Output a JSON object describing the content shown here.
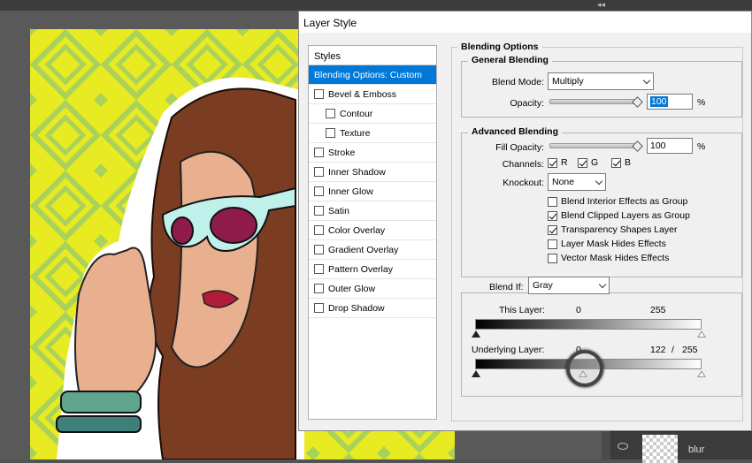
{
  "dialog": {
    "title": "Layer Style"
  },
  "styles_panel": {
    "header": "Styles",
    "items": [
      {
        "label": "Blending Options: Custom",
        "selected": true,
        "checkbox": false,
        "indent": false,
        "checked": false
      },
      {
        "label": "Bevel & Emboss",
        "checkbox": true,
        "indent": false,
        "checked": false
      },
      {
        "label": "Contour",
        "checkbox": true,
        "indent": true,
        "checked": false
      },
      {
        "label": "Texture",
        "checkbox": true,
        "indent": true,
        "checked": false
      },
      {
        "label": "Stroke",
        "checkbox": true,
        "indent": false,
        "checked": false
      },
      {
        "label": "Inner Shadow",
        "checkbox": true,
        "indent": false,
        "checked": false
      },
      {
        "label": "Inner Glow",
        "checkbox": true,
        "indent": false,
        "checked": false
      },
      {
        "label": "Satin",
        "checkbox": true,
        "indent": false,
        "checked": false
      },
      {
        "label": "Color Overlay",
        "checkbox": true,
        "indent": false,
        "checked": false
      },
      {
        "label": "Gradient Overlay",
        "checkbox": true,
        "indent": false,
        "checked": false
      },
      {
        "label": "Pattern Overlay",
        "checkbox": true,
        "indent": false,
        "checked": false
      },
      {
        "label": "Outer Glow",
        "checkbox": true,
        "indent": false,
        "checked": false
      },
      {
        "label": "Drop Shadow",
        "checkbox": true,
        "indent": false,
        "checked": false
      }
    ]
  },
  "blending_options": {
    "title": "Blending Options",
    "general": {
      "title": "General Blending",
      "blend_mode_label": "Blend Mode:",
      "blend_mode_value": "Multiply",
      "opacity_label": "Opacity:",
      "opacity_value": "100",
      "opacity_level": 1.0,
      "percent": "%"
    },
    "advanced": {
      "title": "Advanced Blending",
      "fill_opacity_label": "Fill Opacity:",
      "fill_opacity_value": "100",
      "fill_opacity_level": 1.0,
      "percent": "%",
      "channels_label": "Channels:",
      "channel_r": "R",
      "channel_g": "G",
      "channel_b": "B",
      "knockout_label": "Knockout:",
      "knockout_value": "None",
      "checks": [
        {
          "label": "Blend Interior Effects as Group",
          "checked": false
        },
        {
          "label": "Blend Clipped Layers as Group",
          "checked": true
        },
        {
          "label": "Transparency Shapes Layer",
          "checked": true
        },
        {
          "label": "Layer Mask Hides Effects",
          "checked": false
        },
        {
          "label": "Vector Mask Hides Effects",
          "checked": false
        }
      ]
    },
    "blend_if": {
      "label": "Blend If:",
      "value": "Gray",
      "this_layer_label": "This Layer:",
      "this_layer_low": "0",
      "this_layer_high": "255",
      "underlying_label": "Underlying Layer:",
      "underlying_low": "0",
      "underlying_mid": "122",
      "underlying_sep": "/",
      "underlying_high": "255"
    }
  },
  "layers_panel": {
    "layer_name": "blur"
  },
  "colors": {
    "selection": "#0078d7",
    "dialog_bg": "#f0f0f0",
    "ps_bg": "#535353",
    "canvas_yellow": "#e6e81e"
  }
}
